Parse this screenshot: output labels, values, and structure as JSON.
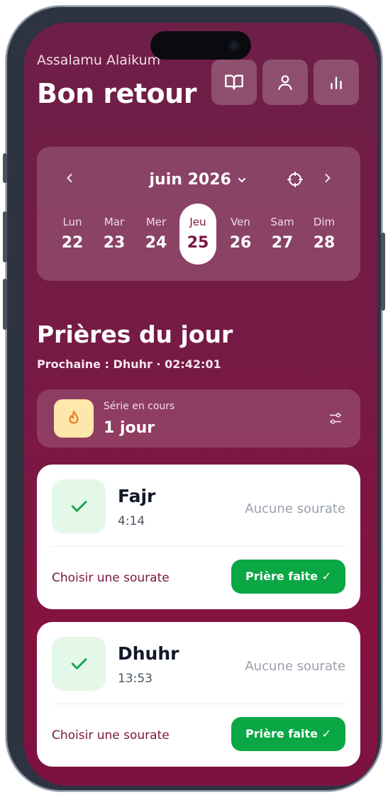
{
  "header": {
    "greeting": "Assalamu Alaikum",
    "title": "Bon retour",
    "buttons": [
      {
        "icon": "book-icon"
      },
      {
        "icon": "user-icon"
      },
      {
        "icon": "bar-chart-icon"
      }
    ]
  },
  "calendar": {
    "month_label": "juin 2026",
    "days": [
      {
        "name": "Lun",
        "date": "22",
        "selected": false
      },
      {
        "name": "Mar",
        "date": "23",
        "selected": false
      },
      {
        "name": "Mer",
        "date": "24",
        "selected": false
      },
      {
        "name": "Jeu",
        "date": "25",
        "selected": true
      },
      {
        "name": "Ven",
        "date": "26",
        "selected": false
      },
      {
        "name": "Sam",
        "date": "27",
        "selected": false
      },
      {
        "name": "Dim",
        "date": "28",
        "selected": false
      }
    ]
  },
  "prayers_section": {
    "title": "Prières du jour",
    "next": "Prochaine : Dhuhr · 02:42:01"
  },
  "streak": {
    "label": "Série en cours",
    "value": "1 jour"
  },
  "prayers": [
    {
      "name": "Fajr",
      "time": "4:14",
      "surah_status": "Aucune sourate",
      "choose": "Choisir une sourate",
      "done_label": "Prière faite ✓"
    },
    {
      "name": "Dhuhr",
      "time": "13:53",
      "surah_status": "Aucune sourate",
      "choose": "Choisir une sourate",
      "done_label": "Prière faite ✓"
    }
  ],
  "colors": {
    "background": "#7c1a45",
    "accent_green": "#0aa744",
    "streak_icon_bg": "#fde7aa"
  }
}
